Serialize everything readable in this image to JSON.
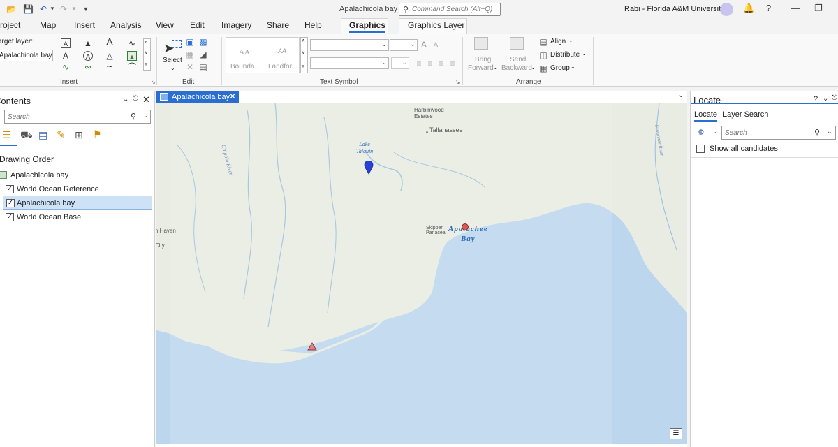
{
  "titlebar": {
    "project_name": "Apalachicola bay",
    "command_search_placeholder": "Command Search (Alt+Q)",
    "user": "Rabi  - Florida A&M University",
    "help": "?"
  },
  "tabs": [
    {
      "label": "Project"
    },
    {
      "label": "Map"
    },
    {
      "label": "Insert"
    },
    {
      "label": "Analysis"
    },
    {
      "label": "View"
    },
    {
      "label": "Edit"
    },
    {
      "label": "Imagery"
    },
    {
      "label": "Share"
    },
    {
      "label": "Help"
    },
    {
      "label": "Graphics"
    },
    {
      "label": "Graphics Layer"
    }
  ],
  "ribbon": {
    "target_layer_label": "Target layer:",
    "target_layer_value": "Apalachicola bay",
    "groups": {
      "insert": "Insert",
      "edit": "Edit",
      "text_symbol": "Text Symbol",
      "arrange": "Arrange"
    },
    "select_label": "Select",
    "gallery_items": [
      "Bounda...",
      "Landfor..."
    ],
    "gallery_sample": [
      "AA",
      "AA"
    ],
    "font_grow": "A",
    "font_shrink": "A",
    "bring_forward": [
      "Bring",
      "Forward"
    ],
    "send_backward": [
      "Send",
      "Backward"
    ],
    "align": "Align",
    "distribute": "Distribute",
    "group": "Group"
  },
  "contents": {
    "title": "Contents",
    "search_placeholder": "Search",
    "section": "Drawing Order",
    "map_name": "Apalachicola bay",
    "layers": [
      {
        "name": "World Ocean Reference",
        "checked": true,
        "selected": false
      },
      {
        "name": "Apalachicola bay",
        "checked": true,
        "selected": true
      },
      {
        "name": "World Ocean Base",
        "checked": true,
        "selected": false
      }
    ]
  },
  "map": {
    "tab_label": "Apalachicola bay",
    "labels": {
      "harbinwood": [
        "Harbinwood",
        "Estates"
      ],
      "tallahassee": "Tallahassee",
      "lake": [
        "Lake",
        "Talquin"
      ],
      "chipola": "Chipola River",
      "suwannee": "Suwannee River",
      "skipper": "Skipper",
      "panacea": "Panacea",
      "apalachee": [
        "Apalachee",
        "Bay"
      ],
      "haven": "n Haven",
      "city": "City"
    }
  },
  "locate": {
    "title": "Locate",
    "tabs": [
      "Locate",
      "Layer Search"
    ],
    "search_placeholder": "Search",
    "show_all": "Show all candidates"
  }
}
